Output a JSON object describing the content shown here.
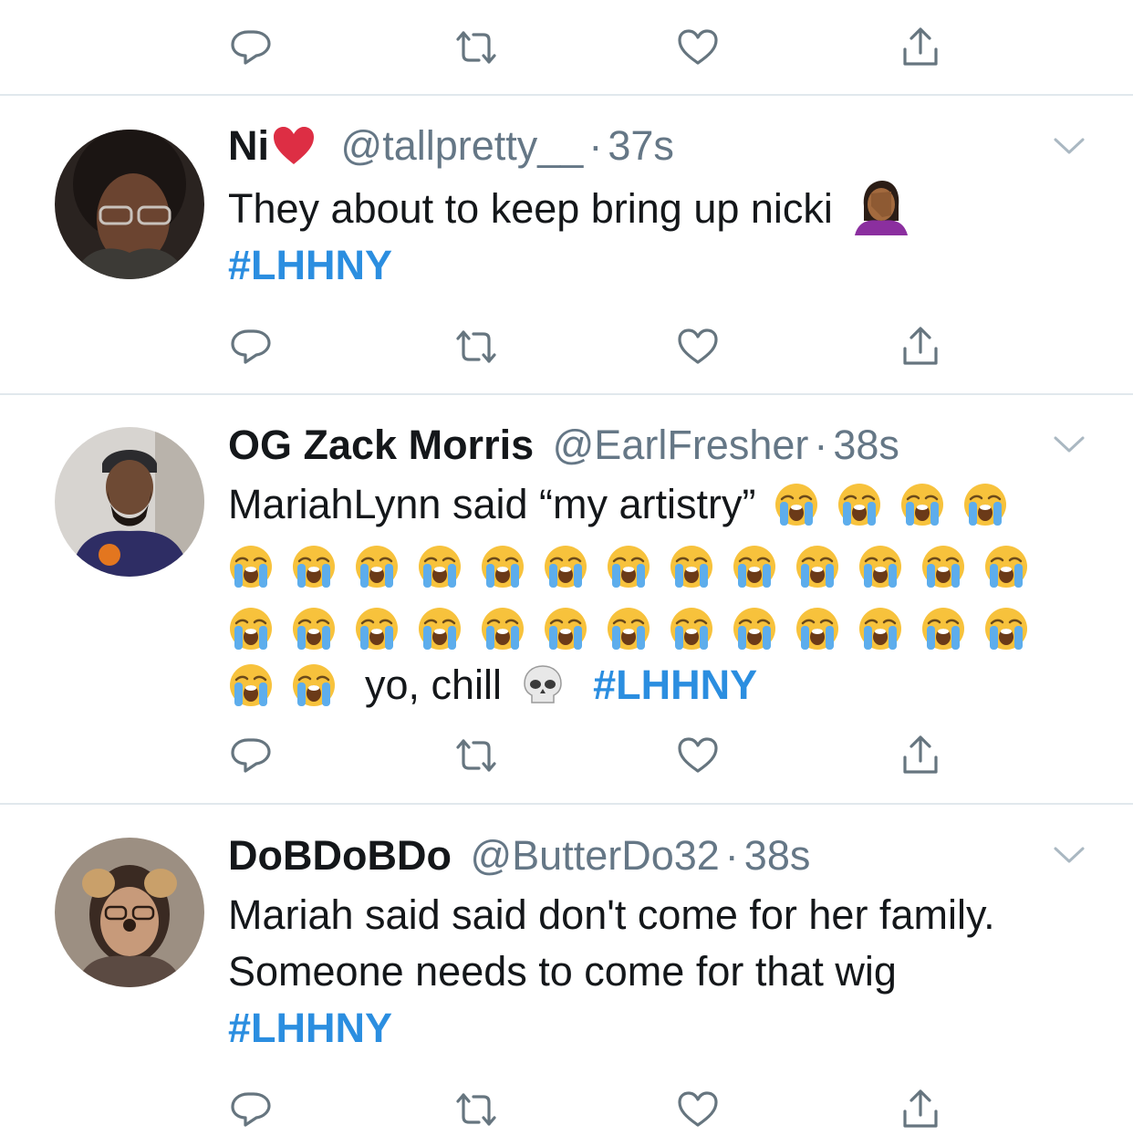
{
  "tweets": [
    {
      "name": "Ni",
      "handle": "@tallpretty__",
      "time": "37s",
      "separator": "·",
      "name_emoji": "red-heart-emoji",
      "text": "They about to keep bring up nicki",
      "text_emoji": "woman-facepalming-emoji",
      "hashtag": "#LHHNY"
    },
    {
      "name": "OG Zack Morris",
      "handle": "@EarlFresher",
      "time": "38s",
      "separator": "·",
      "text_line1": "MariahLynn said “my artistry”",
      "emoji": "loudly-crying-face-emoji",
      "crying_count": 30,
      "text_tail": "yo, chill",
      "tail_emoji": "skull-emoji",
      "hashtag": "#LHHNY"
    },
    {
      "name": "DoBDoBDo",
      "handle": "@ButterDo32",
      "time": "38s",
      "separator": "·",
      "text_line1": "Mariah said said don't come for her family.",
      "text_line2": "Someone needs to come for that wig",
      "hashtag": "#LHHNY"
    }
  ],
  "actions": [
    "reply-icon",
    "retweet-icon",
    "like-icon",
    "share-icon"
  ],
  "colors": {
    "hashtag": "#2b8ee0",
    "meta": "#657786",
    "icon": "#66757f",
    "divider": "#e1e8ed"
  }
}
